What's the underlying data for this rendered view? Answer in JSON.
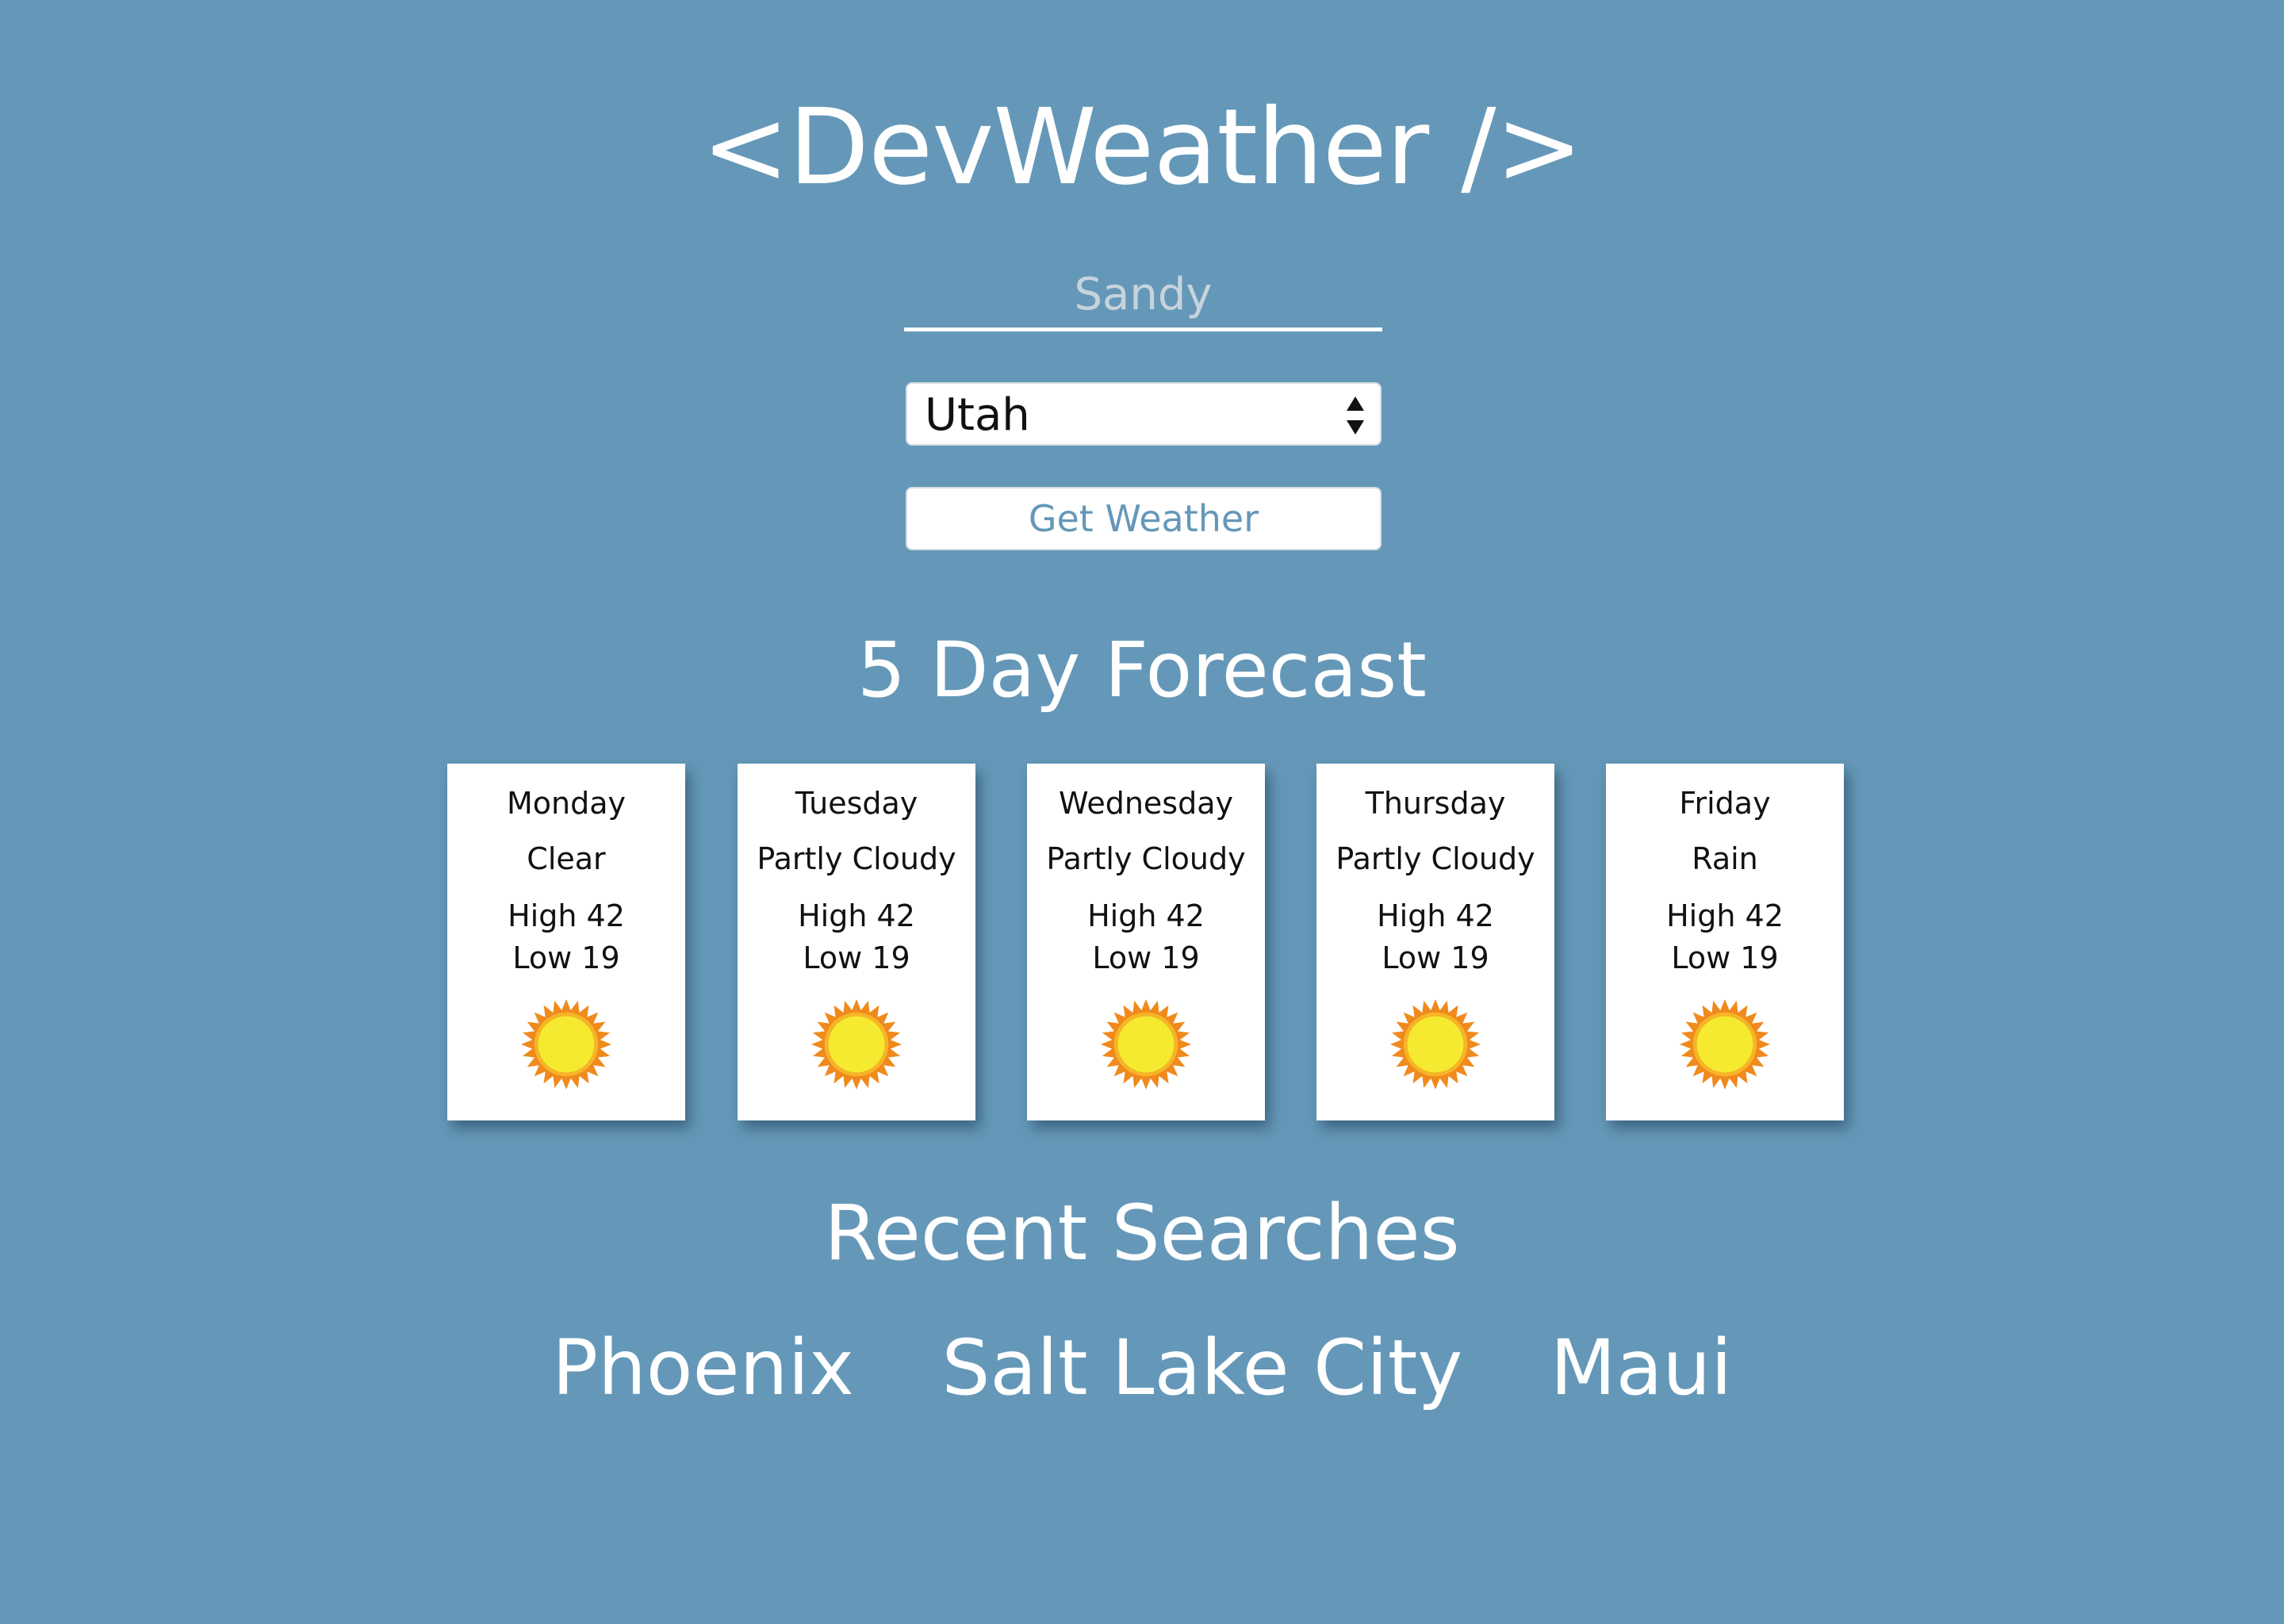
{
  "app": {
    "title": "<DevWeather />"
  },
  "search": {
    "city_placeholder": "Sandy",
    "state_value": "Utah",
    "submit_label": "Get Weather"
  },
  "forecast": {
    "heading": "5 Day Forecast",
    "days": [
      {
        "day": "Monday",
        "condition": "Clear",
        "high": "High 42",
        "low": "Low 19",
        "icon": "sun-icon"
      },
      {
        "day": "Tuesday",
        "condition": "Partly Cloudy",
        "high": "High 42",
        "low": "Low 19",
        "icon": "sun-icon"
      },
      {
        "day": "Wednesday",
        "condition": "Partly Cloudy",
        "high": "High 42",
        "low": "Low 19",
        "icon": "sun-icon"
      },
      {
        "day": "Thursday",
        "condition": "Partly Cloudy",
        "high": "High 42",
        "low": "Low 19",
        "icon": "sun-icon"
      },
      {
        "day": "Friday",
        "condition": "Rain",
        "high": "High 42",
        "low": "Low 19",
        "icon": "sun-icon"
      }
    ]
  },
  "recent": {
    "heading": "Recent Searches",
    "items": [
      "Phoenix",
      "Salt Lake City",
      "Maui"
    ]
  },
  "colors": {
    "background": "#6598b8",
    "card": "#ffffff",
    "sun_fill": "#f5ea2f",
    "sun_rays": "#f08a1c"
  }
}
